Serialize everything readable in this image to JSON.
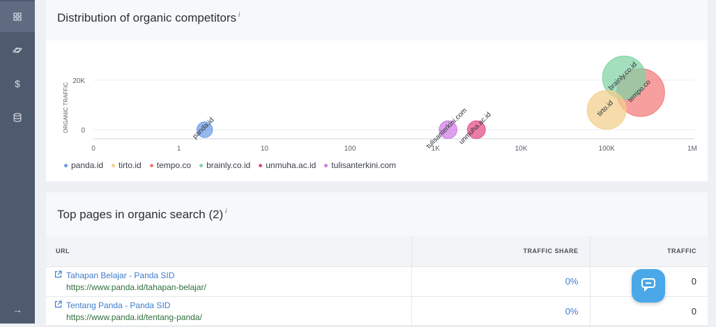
{
  "sidebar": {
    "items": [
      {
        "icon": "grid-icon"
      },
      {
        "icon": "planet-icon"
      },
      {
        "icon": "dollar-icon"
      },
      {
        "icon": "database-icon"
      },
      {
        "icon": "arrow-right-icon"
      }
    ],
    "dollar_glyph": "$",
    "arrow_glyph": "→"
  },
  "competitors": {
    "title": "Distribution of organic competitors",
    "info": "i"
  },
  "chart_data": {
    "type": "scatter",
    "ylabel": "ORGANIC TRAFFIC",
    "xscale": "log",
    "xlim": [
      0,
      1000000
    ],
    "ylim": [
      0,
      20000
    ],
    "x_ticks": [
      "0",
      "1",
      "10",
      "100",
      "1K",
      "10K",
      "100K",
      "1M"
    ],
    "y_ticks": [
      "0",
      "20K"
    ],
    "series": [
      {
        "name": "panda.id",
        "color": "#6c9be6",
        "x": 2,
        "y": 0,
        "size": 0.1
      },
      {
        "name": "tirto.id",
        "color": "#f3cf8a",
        "x": 100000,
        "y": 8000,
        "size": 0.62
      },
      {
        "name": "tempo.co",
        "color": "#f47a7a",
        "x": 250000,
        "y": 15000,
        "size": 0.82
      },
      {
        "name": "brainly.co.id",
        "color": "#80d3a4",
        "x": 160000,
        "y": 21000,
        "size": 0.72
      },
      {
        "name": "unmuha.ac.id",
        "color": "#e54b84",
        "x": 3000,
        "y": 0,
        "size": 0.15
      },
      {
        "name": "tulisanterkini.com",
        "color": "#d07be2",
        "x": 1400,
        "y": 0,
        "size": 0.15
      }
    ],
    "legend_position": "bottom-left"
  },
  "top_pages": {
    "title": "Top pages in organic search (2)",
    "info": "i",
    "columns": {
      "url": "URL",
      "share": "TRAFFIC SHARE",
      "traffic": "TRAFFIC"
    },
    "rows": [
      {
        "title": "Tahapan Belajar - Panda SID",
        "url": "https://www.panda.id/tahapan-belajar/",
        "share": "0%",
        "traffic": "0"
      },
      {
        "title": "Tentang Panda - Panda SID",
        "url": "https://www.panda.id/tentang-panda/",
        "share": "0%",
        "traffic": "0"
      }
    ]
  },
  "colors": {
    "accent": "#3d7cc9",
    "url_green": "#2f6e3b",
    "sidebar": "#4e5a6d",
    "chat": "#4ba8e8"
  }
}
